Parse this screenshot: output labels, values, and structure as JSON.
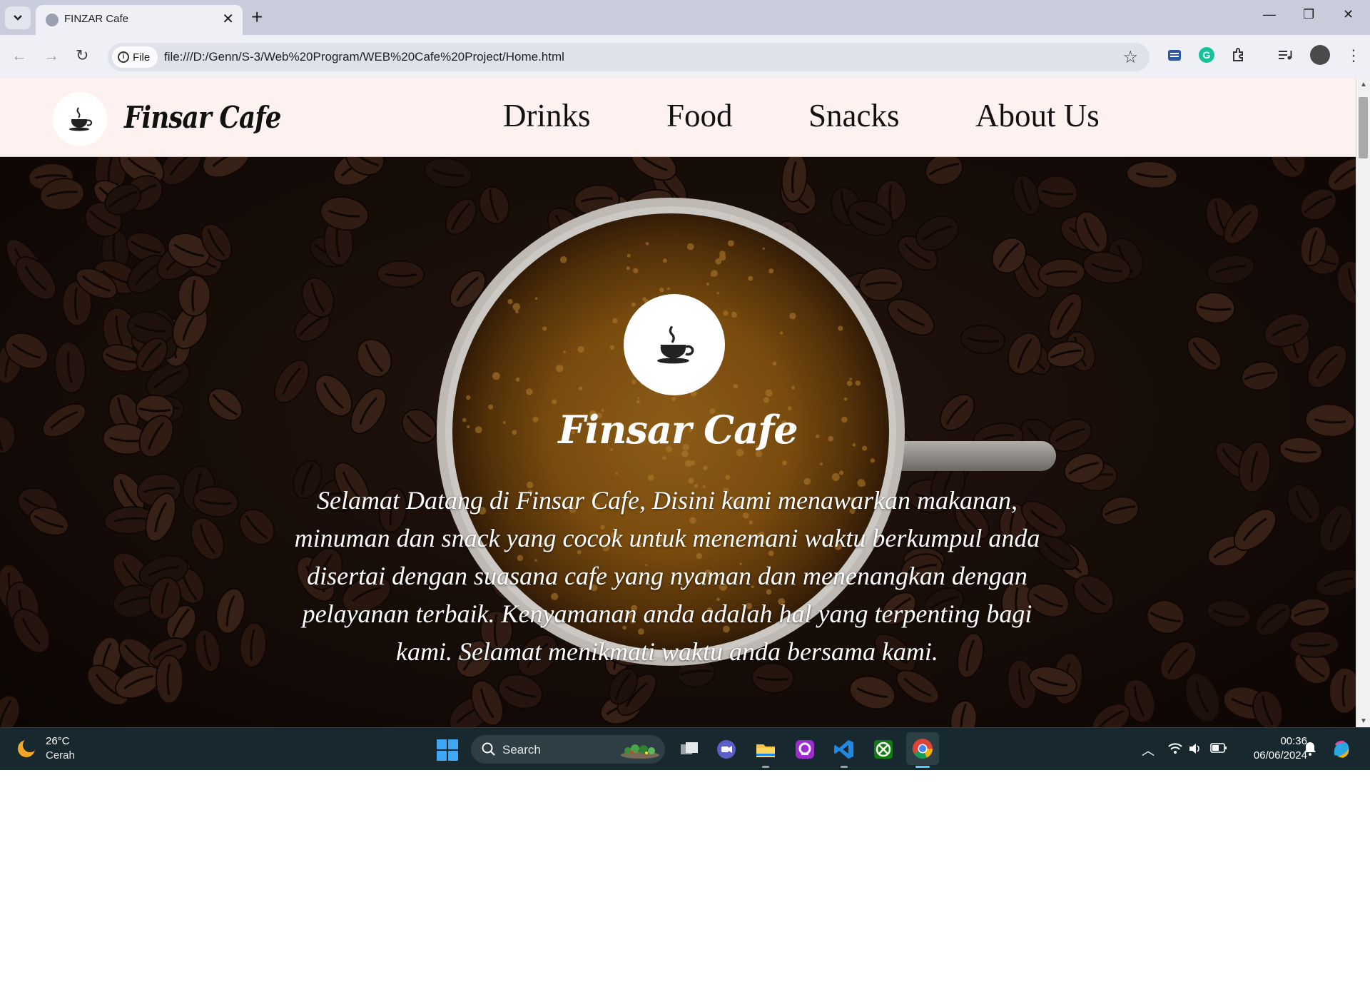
{
  "browser": {
    "tab_title": "FINZAR Cafe",
    "tab_close": "✕",
    "new_tab": "+",
    "chip_label": "File",
    "url": "file:///D:/Genn/S-3/Web%20Program/WEB%20Cafe%20Project/Home.html",
    "icons": [
      "tab-search-icon",
      "back-icon",
      "forward-icon",
      "reload-icon",
      "info-icon",
      "star-icon",
      "extension-icons",
      "profile-avatar",
      "menu-icon"
    ]
  },
  "site": {
    "brand": "Finsar Cafe",
    "nav": [
      {
        "label": "Drinks"
      },
      {
        "label": "Food"
      },
      {
        "label": "Snacks"
      },
      {
        "label": "About Us"
      }
    ],
    "hero": {
      "title": "Finsar Cafe",
      "text": "Selamat Datang di Finsar Cafe, Disini kami menawarkan makanan, minuman dan snack yang cocok untuk menemani waktu berkumpul anda disertai dengan suasana cafe yang nyaman dan menenangkan dengan pelayanan terbaik. Kenyamanan anda adalah hal yang terpenting bagi kami. Selamat menikmati waktu anda bersama kami."
    },
    "colors": {
      "header_bg": "#fdf2ef",
      "hero_text": "#ffffff"
    }
  },
  "taskbar": {
    "weather_temp": "26°C",
    "weather_desc": "Cerah",
    "search_placeholder": "Search",
    "time": "00:36",
    "date": "06/06/2024"
  }
}
